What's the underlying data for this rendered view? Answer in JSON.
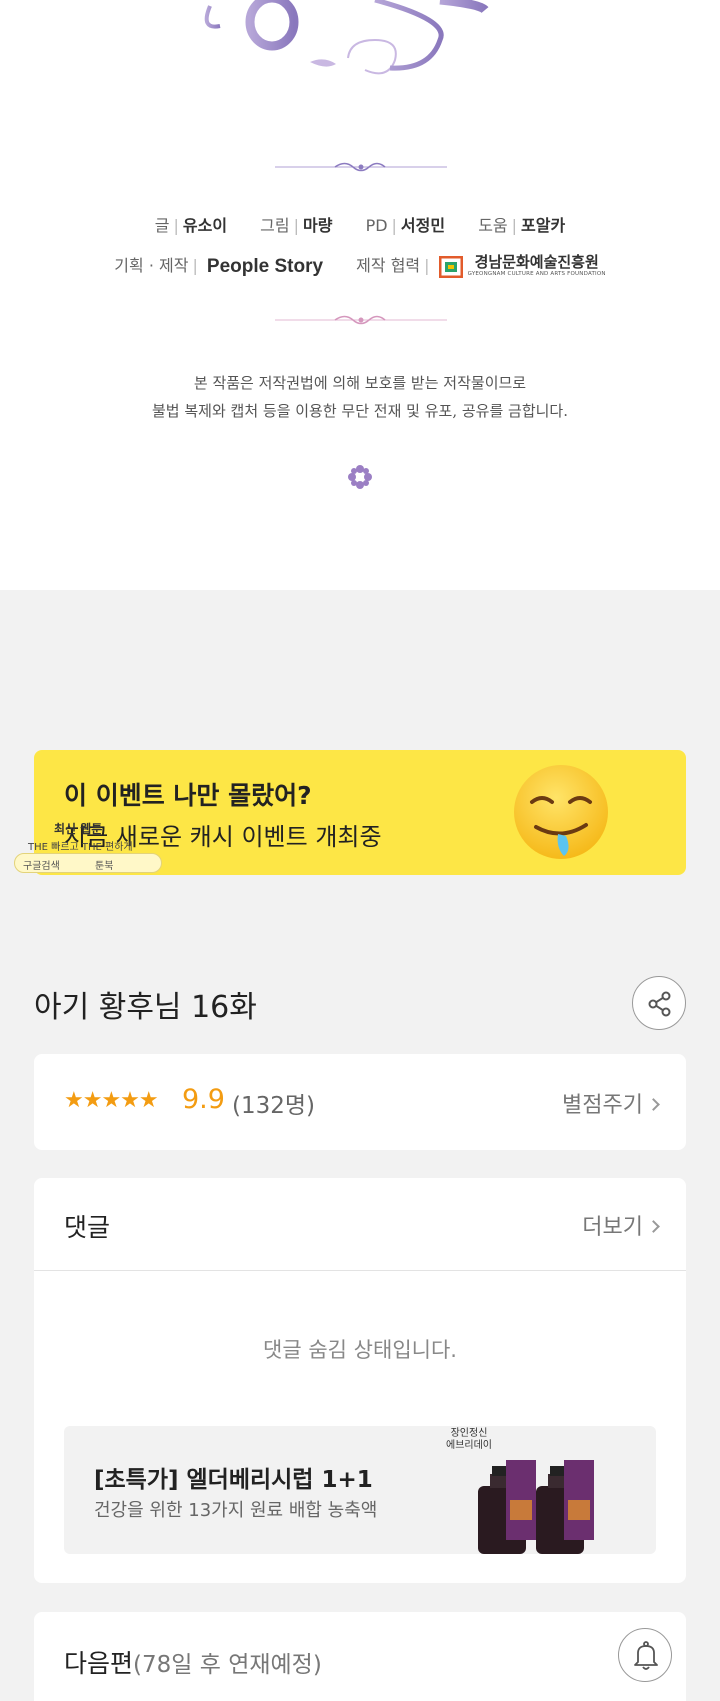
{
  "credits": {
    "row1": [
      {
        "role": "글",
        "name": "유소이"
      },
      {
        "role": "그림",
        "name": "마량"
      },
      {
        "role": "PD",
        "name": "서정민"
      },
      {
        "role": "도움",
        "name": "포알카"
      }
    ],
    "row2": {
      "producer_role": "기획 · 제작",
      "producer_logo": "People Story",
      "partner_role": "제작 협력",
      "partner_name": "경남문화예술진흥원",
      "partner_name_en": "GYEONGNAM CULTURE AND ARTS FOUNDATION"
    },
    "notice_line1": "본 작품은 저작권법에 의해 보호를 받는 저작물이므로",
    "notice_line2": "불법 복제와 캡처 등을 이용한 무단 전재 및 유포, 공유를 금합니다."
  },
  "event_banner": {
    "title": "이 이벤트 나만 몰랐어?",
    "subtitle": "지금 새로운 캐시 이벤트 개최중",
    "icon": "drooling-face-emoji",
    "color": "#fde646"
  },
  "mini_widget": {
    "title": "최신 웹툰",
    "subtitle": "THE 빠르고 THE 편하게",
    "google_label": "구글검색",
    "toon_label": "툰북"
  },
  "episode": {
    "title": "아기 황후님 16화",
    "share_icon": "share-icon"
  },
  "rating": {
    "stars": "★★★★★",
    "score": "9.9",
    "votes": "(132명)",
    "rate_label": "별점주기"
  },
  "comments": {
    "title": "댓글",
    "more_label": "더보기",
    "hidden_message": "댓글 숨김 상태입니다."
  },
  "ad": {
    "title": "[초특가] 엘더베리시럽 1+1",
    "subtitle": "건강을 위한 13가지 원료 배합 농축액",
    "brand_line1": "장인정신",
    "brand_line2": "에브리데이"
  },
  "next_episode": {
    "label": "다음편",
    "note": "(78일 후 연재예정)",
    "bell_icon": "bell-icon"
  },
  "colors": {
    "accent_star": "#f39c12",
    "banner_yellow": "#fde646",
    "ornament_purple": "#9b7fc4"
  }
}
